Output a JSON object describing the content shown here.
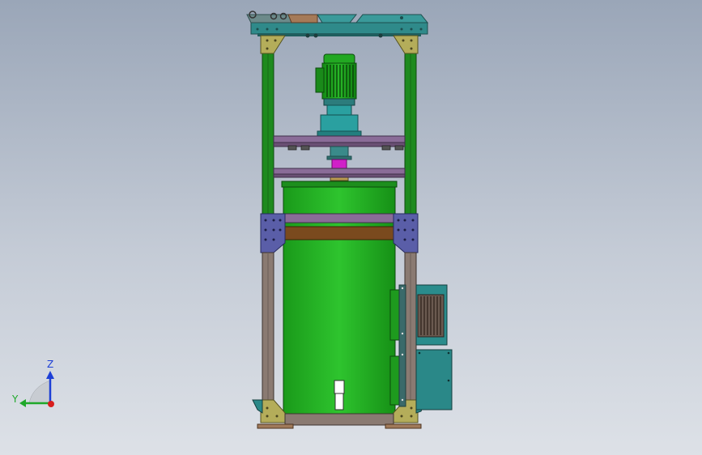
{
  "viewport": {
    "background_top": "#9aa6b8",
    "background_bottom": "#dde1e7"
  },
  "triad": {
    "z_label": "Z",
    "y_label": "Y",
    "z_color": "#1d3fd6",
    "y_color": "#1fa82a",
    "x_color": "#d81e1e"
  },
  "colors": {
    "frame_green": "#1e8a1e",
    "frame_taupe": "#8a7a72",
    "tank_green": "#22b522",
    "gusset_olive": "#b4ad5a",
    "gusset_blue": "#5a5ea8",
    "platform_purple": "#8a6c98",
    "top_teal": "#2a8c8c",
    "motor_green": "#1ea01e",
    "gearbox_teal": "#2aa0a0",
    "coupling_magenta": "#d020c8",
    "band_brown": "#7a4a1e",
    "box_teal": "#2a8888"
  }
}
